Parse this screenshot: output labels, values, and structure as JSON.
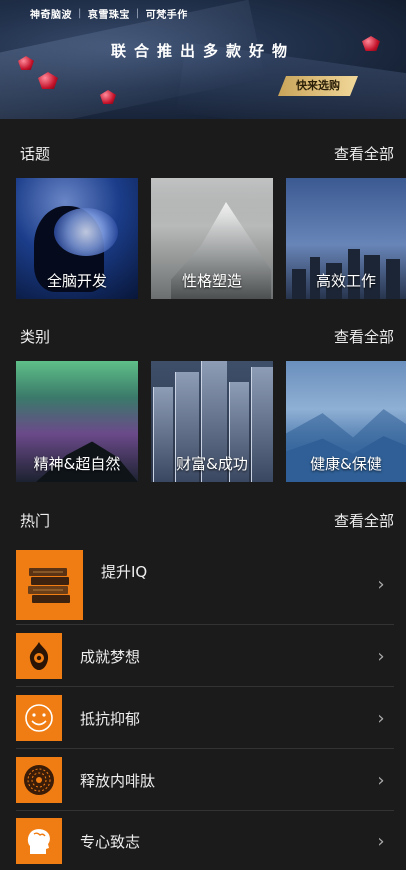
{
  "banner": {
    "brands": [
      "神奇脑波",
      "哀雪珠宝",
      "可梵手作"
    ],
    "title": "联合推出多款好物",
    "cta": "快来选购"
  },
  "topics": {
    "title": "话题",
    "view_all": "查看全部",
    "items": [
      {
        "label": "全脑开发"
      },
      {
        "label": "性格塑造"
      },
      {
        "label": "高效工作"
      }
    ]
  },
  "categories": {
    "title": "类别",
    "view_all": "查看全部",
    "items": [
      {
        "label": "精神&超自然"
      },
      {
        "label": "财富&成功"
      },
      {
        "label": "健康&保健"
      }
    ]
  },
  "hot": {
    "title": "热门",
    "view_all": "查看全部",
    "items": [
      {
        "label": "提升IQ",
        "icon": "books-icon"
      },
      {
        "label": "成就梦想",
        "icon": "fire-icon"
      },
      {
        "label": "抵抗抑郁",
        "icon": "smile-icon"
      },
      {
        "label": "释放内啡肽",
        "icon": "pattern-icon"
      },
      {
        "label": "专心致志",
        "icon": "head-icon"
      }
    ]
  },
  "colors": {
    "background": "#1b1b1b",
    "accent_orange": "#f07d13",
    "banner_gold": "#e6c581"
  }
}
